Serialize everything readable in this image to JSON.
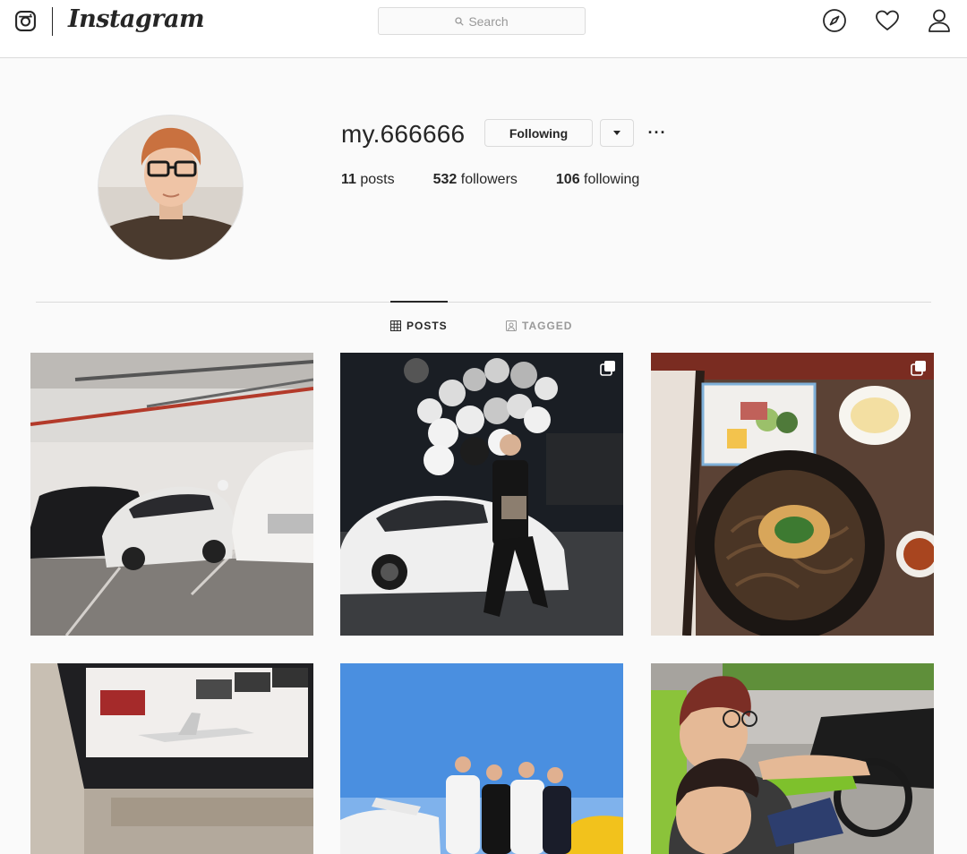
{
  "header": {
    "wordmark": "Instagram",
    "search_placeholder": "Search",
    "icons": [
      "instagram-glyph-icon",
      "search-icon",
      "compass-icon",
      "heart-icon",
      "person-icon"
    ]
  },
  "profile": {
    "username": "my.666666",
    "follow_button": "Following",
    "more": "···",
    "stats": {
      "posts_count": "11",
      "posts_label": " posts",
      "followers_count": "532",
      "followers_label": " followers",
      "following_count": "106",
      "following_label": " following"
    }
  },
  "tabs": [
    {
      "label": "POSTS",
      "active": true,
      "icon": "grid-icon"
    },
    {
      "label": "TAGGED",
      "active": false,
      "icon": "tag-icon"
    }
  ],
  "posts": [
    {
      "subject": "white-sports-cars-in-garage",
      "multiple": false
    },
    {
      "subject": "man-on-white-lamborghini-with-balloons",
      "multiple": true
    },
    {
      "subject": "soba-noodle-meal",
      "multiple": true
    },
    {
      "subject": "in-flight-screen-airplane",
      "multiple": false
    },
    {
      "subject": "group-of-men-blue-sky",
      "multiple": false
    },
    {
      "subject": "two-young-men-in-car",
      "multiple": false
    }
  ],
  "colors": {
    "background": "#fafafa",
    "border": "#dbdbdb",
    "text": "#262626",
    "muted": "#999999"
  }
}
